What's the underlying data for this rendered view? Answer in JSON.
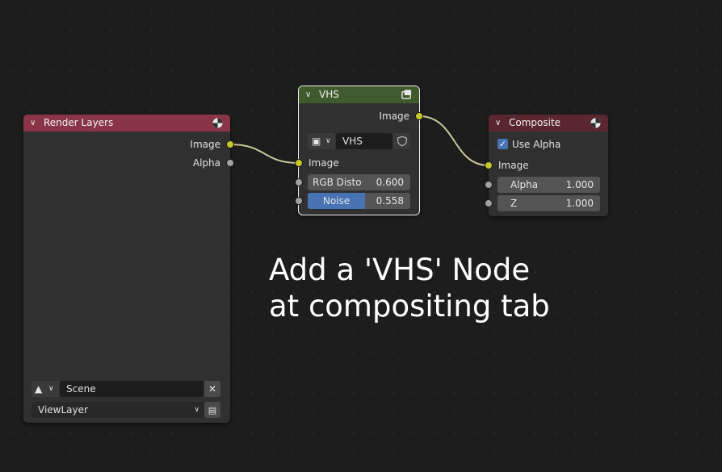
{
  "colors": {
    "render_layers_header": "#8a3448",
    "vhs_header": "#3f5a2c",
    "composite_header": "#5a2630",
    "socket_image": "#c7c729",
    "socket_value": "#a1a1a1",
    "slider_fill": "#4772b3"
  },
  "render_layers": {
    "title": "Render Layers",
    "header_icon": "render-sphere-icon",
    "outputs": [
      "Image",
      "Alpha"
    ],
    "scene_icon": "scene-icon",
    "scene_value": "Scene",
    "clear_icon": "close-icon",
    "view_layer_value": "ViewLayer",
    "view_layer_icon": "render-layers-icon"
  },
  "vhs": {
    "title": "VHS",
    "header_icon": "node-group-icon",
    "output": "Image",
    "image_icon": "image-browse-icon",
    "image_name": "VHS",
    "fake_user_icon": "shield-icon",
    "input_image": "Image",
    "rgb_label": "RGB Disto",
    "rgb_value": "0.600",
    "noise_label": "Noise",
    "noise_value": "0.558",
    "noise_fraction": 0.558
  },
  "composite": {
    "title": "Composite",
    "header_icon": "render-sphere-icon",
    "use_alpha_label": "Use Alpha",
    "use_alpha_checked": true,
    "input_image": "Image",
    "alpha_label": "Alpha",
    "alpha_value": "1.000",
    "z_label": "Z",
    "z_value": "1.000"
  },
  "caption": {
    "line1": "Add a 'VHS' Node",
    "line2": "at compositing tab"
  }
}
